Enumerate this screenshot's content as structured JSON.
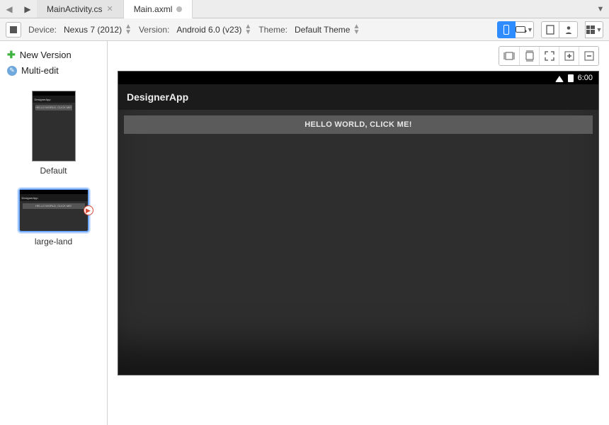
{
  "tabs": {
    "inactive": {
      "label": "MainActivity.cs"
    },
    "active": {
      "label": "Main.axml"
    }
  },
  "toolbar": {
    "device_label": "Device:",
    "device_value": "Nexus 7 (2012)",
    "version_label": "Version:",
    "version_value": "Android 6.0 (v23)",
    "theme_label": "Theme:",
    "theme_value": "Default Theme"
  },
  "sidebar": {
    "new_version": "New Version",
    "multi_edit": "Multi-edit",
    "thumbs": {
      "default": "Default",
      "large_land": "large-land"
    },
    "mini_app_title": "DesignerApp",
    "mini_button": "HELLO WORLD, CLICK ME!"
  },
  "device": {
    "time": "6:00",
    "app_title": "DesignerApp",
    "button_text": "HELLO WORLD, CLICK ME!"
  }
}
